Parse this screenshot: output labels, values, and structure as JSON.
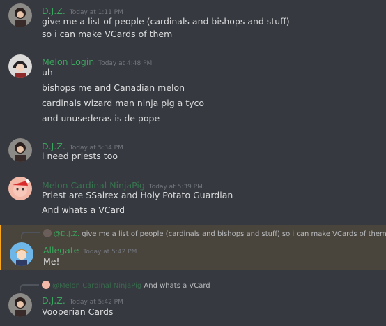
{
  "colors": {
    "background": "#36393f",
    "author_green": "#3ba55d",
    "text": "#dcddde",
    "timestamp": "#72767d",
    "mention_highlight": "#49443c",
    "mention_bar": "#faa61a"
  },
  "messages": [
    {
      "author": "D.J.Z.",
      "time": "Today at 1:11 PM",
      "avatar_icon": "djz-avatar-icon",
      "lines": [
        "give me a list of people (cardinals and bishops and stuff)",
        "so i can make VCards of them"
      ]
    },
    {
      "author": "Melon Login",
      "time": "Today at 4:48 PM",
      "avatar_icon": "melon-login-avatar-icon",
      "lines": [
        "uh",
        "bishops me and Canadian melon",
        "cardinals wizard man ninja pig a tyco",
        "and unusederas is de pope"
      ]
    },
    {
      "author": "D.J.Z.",
      "time": "Today at 5:34 PM",
      "avatar_icon": "djz-avatar-icon",
      "lines": [
        "i need priests too"
      ]
    },
    {
      "author": "Melon Cardinal NinjaPig",
      "time": "Today at 5:39 PM",
      "avatar_icon": "ninjapig-avatar-icon",
      "lines": [
        "Priest are SSairex and Holy Potato Guardian",
        "And whats a VCard"
      ]
    },
    {
      "reply_to": "@D.J.Z.",
      "reply_text": "give me a list of people (cardinals and bishops and stuff) so i can make VCards of them",
      "author": "Allegate",
      "time": "Today at 5:42 PM",
      "avatar_icon": "allegate-avatar-icon",
      "lines": [
        "Me!"
      ]
    },
    {
      "reply_to": "@Melon Cardinal NinjaPig",
      "reply_text": "And whats a VCard",
      "author": "D.J.Z.",
      "time": "Today at 5:42 PM",
      "avatar_icon": "djz-avatar-icon",
      "lines": [
        "Vooperian Cards"
      ]
    }
  ]
}
